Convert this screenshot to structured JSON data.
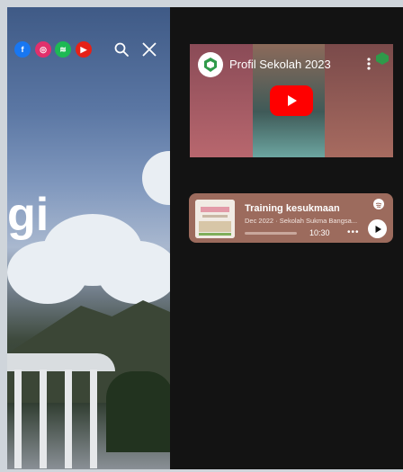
{
  "header": {
    "social_icons": [
      {
        "name": "facebook-icon",
        "glyph": "f",
        "color": "#1877f2"
      },
      {
        "name": "instagram-icon",
        "glyph": "◎",
        "color": "#e1306c"
      },
      {
        "name": "spotify-icon",
        "glyph": "≋",
        "color": "#1db954"
      },
      {
        "name": "youtube-icon",
        "glyph": "▶",
        "color": "#e62117"
      }
    ]
  },
  "hero": {
    "big_letters": "gi"
  },
  "video": {
    "title": "Profil Sekolah 2023",
    "accent": "#ff0000"
  },
  "podcast": {
    "title": "Training kesukmaan",
    "subtitle": "Dec 2022 · Sekolah Sukma Bangsa...",
    "duration": "10:30",
    "more": "•••",
    "card_color": "#9c6b5d"
  }
}
